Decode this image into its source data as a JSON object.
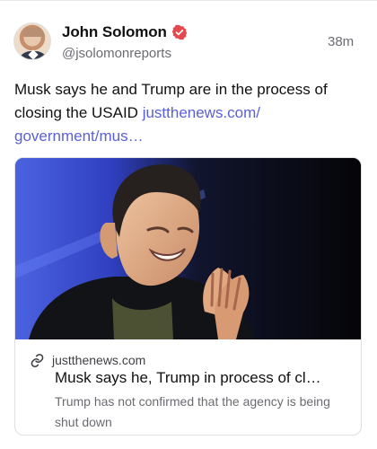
{
  "post": {
    "author_name": "John Solomon",
    "handle": "@jsolomonreports",
    "timestamp": "38m",
    "text": "Musk says he and Trump are in the process of closing the USAID ",
    "link_text": "justthenews.com/\ngovernment/mus…",
    "verified_color": "#e5484d"
  },
  "card": {
    "domain": "justthenews.com",
    "title": "Musk says he, Trump in process of cl…",
    "description": "Trump has not confirmed that the agency is being shut down",
    "link_icon": "link-icon"
  },
  "colors": {
    "link": "#5b5fd6",
    "secondary_text": "#6b6b72",
    "border": "#dedee3"
  }
}
